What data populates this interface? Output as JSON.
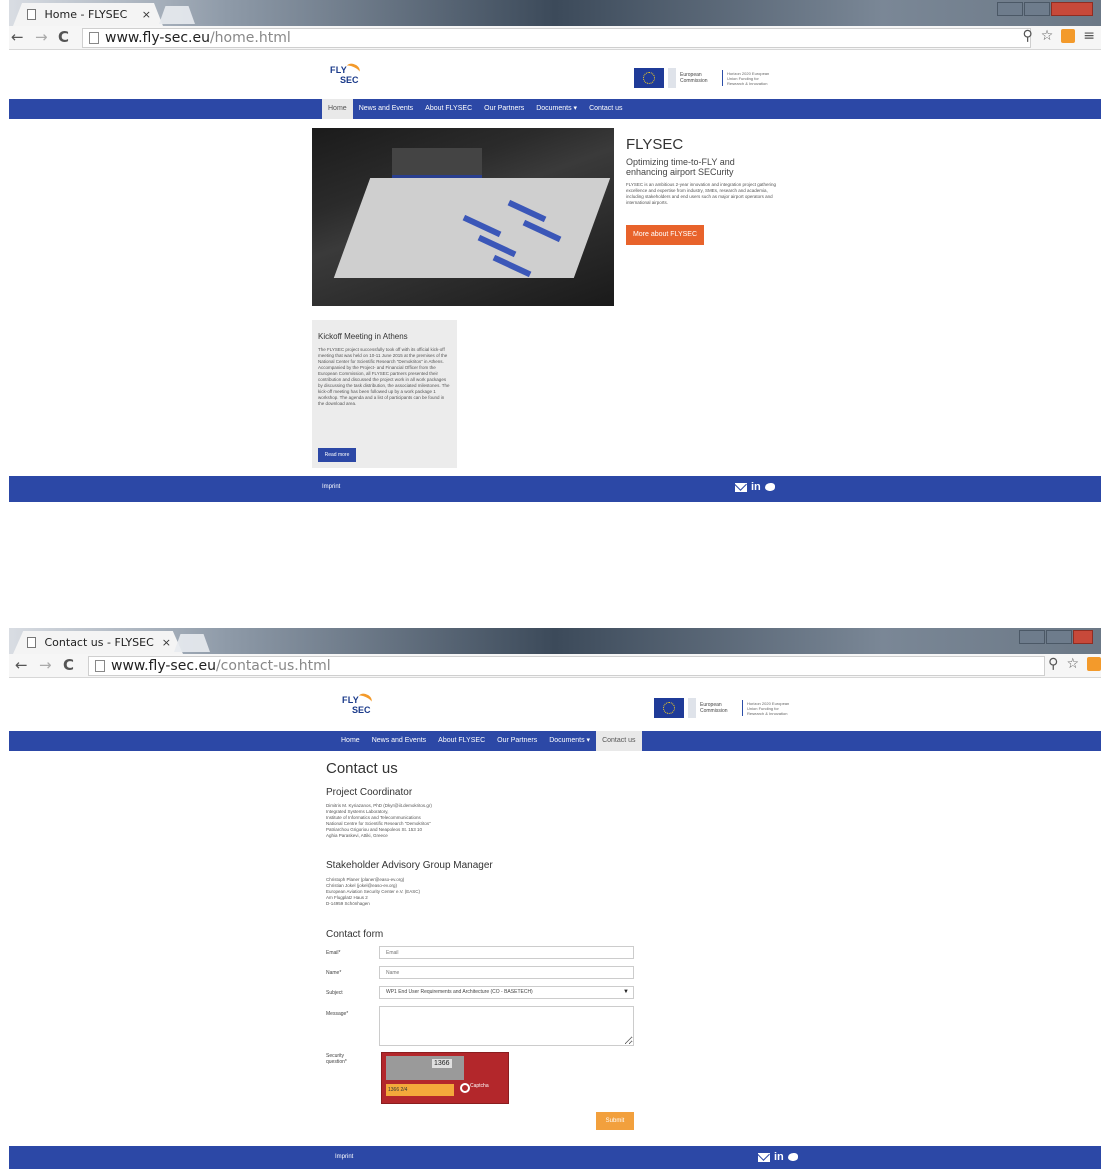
{
  "window1": {
    "tab_title": "Home - FLYSEC",
    "tab_close": "×",
    "url_host": "www.fly-sec.eu",
    "url_path": "/home.html"
  },
  "window2": {
    "tab_title": "Contact us - FLYSEC",
    "tab_close": "×",
    "url_host": "www.fly-sec.eu",
    "url_path": "/contact-us.html"
  },
  "browser": {
    "back": "←",
    "forward": "→",
    "reload": "C",
    "zoom": "⚲",
    "star": "☆",
    "menu": "≡"
  },
  "site": {
    "logo_top": "FLY",
    "logo_bottom": "SEC",
    "ec_name": "European Commission",
    "ec_funding": "Horizon 2020 European Union Funding for Research & Innovation",
    "nav": [
      "Home",
      "News and Events",
      "About FLYSEC",
      "Our Partners",
      "Documents ▾",
      "Contact us"
    ],
    "footer_imprint": "Imprint",
    "footer_in": "in"
  },
  "home": {
    "title": "FLYSEC",
    "subtitle": "Optimizing time-to-FLY and enhancing airport SECurity",
    "intro": "FLYSEC is an ambitious 2-year innovation and integration project gathering excellence and expertise from industry, SMEs, research and academia, including stakeholders and end users such as major airport operators and international airports.",
    "more_button": "More about FLYSEC",
    "news_title": "Kickoff Meeting in Athens",
    "news_body": "The FLYSEC project successfully took off with its official kick-off meeting that was held on 10-11 June 2015 at the premises of the National Center for Scientific Research \"Demokritos\" in Athens. Accompanied by the Project- and Financial Officer from the European Commission, all FLYSEC partners presented their contribution and discussed the project work in all work packages by discussing the task distribution, the associated milestones. The kick-off meeting has been followed up by a work package 1 workshop. The agenda and a list of participants can be found in the download area.",
    "read_more": "Read more"
  },
  "contact": {
    "title": "Contact us",
    "coordinator_heading": "Project Coordinator",
    "coordinator_lines": [
      "Dimitris M. Kyriazanos, PhD (Dkyr@iit.demokritos.gr)",
      "Integrated Systems Laboratory,",
      "Institute of Informatics and Telecommunications",
      "National Centre for Scientific Research \"Demokritos\"",
      "Patriarchou Grigoriou and Neapoleos St. 153 10",
      "Aghia Paraskevi, Attiki, Greece"
    ],
    "sag_heading": "Stakeholder Advisory Group Manager",
    "sag_lines": [
      "Christoph Planer (planer@easo-ev.org)",
      "Christian Jokel (jokel@easo-ev.org)",
      "European Aviation Security Center e.V. (EASC)",
      "Am Flugplatz Haus 2",
      "D-14959 Schönhagen"
    ],
    "form_heading": "Contact form",
    "email_label": "Email*",
    "email_placeholder": "Email",
    "name_label": "Name*",
    "name_placeholder": "Name",
    "subject_label": "Subject",
    "subject_value": "WP1 End User Requirements and Architecture (CO - BASETECH)",
    "message_label": "Message*",
    "security_label": "Security question*",
    "captcha_number": "1366",
    "captcha_input": "1366 2/4",
    "captcha_brand": "Captcha",
    "submit": "Submit"
  }
}
